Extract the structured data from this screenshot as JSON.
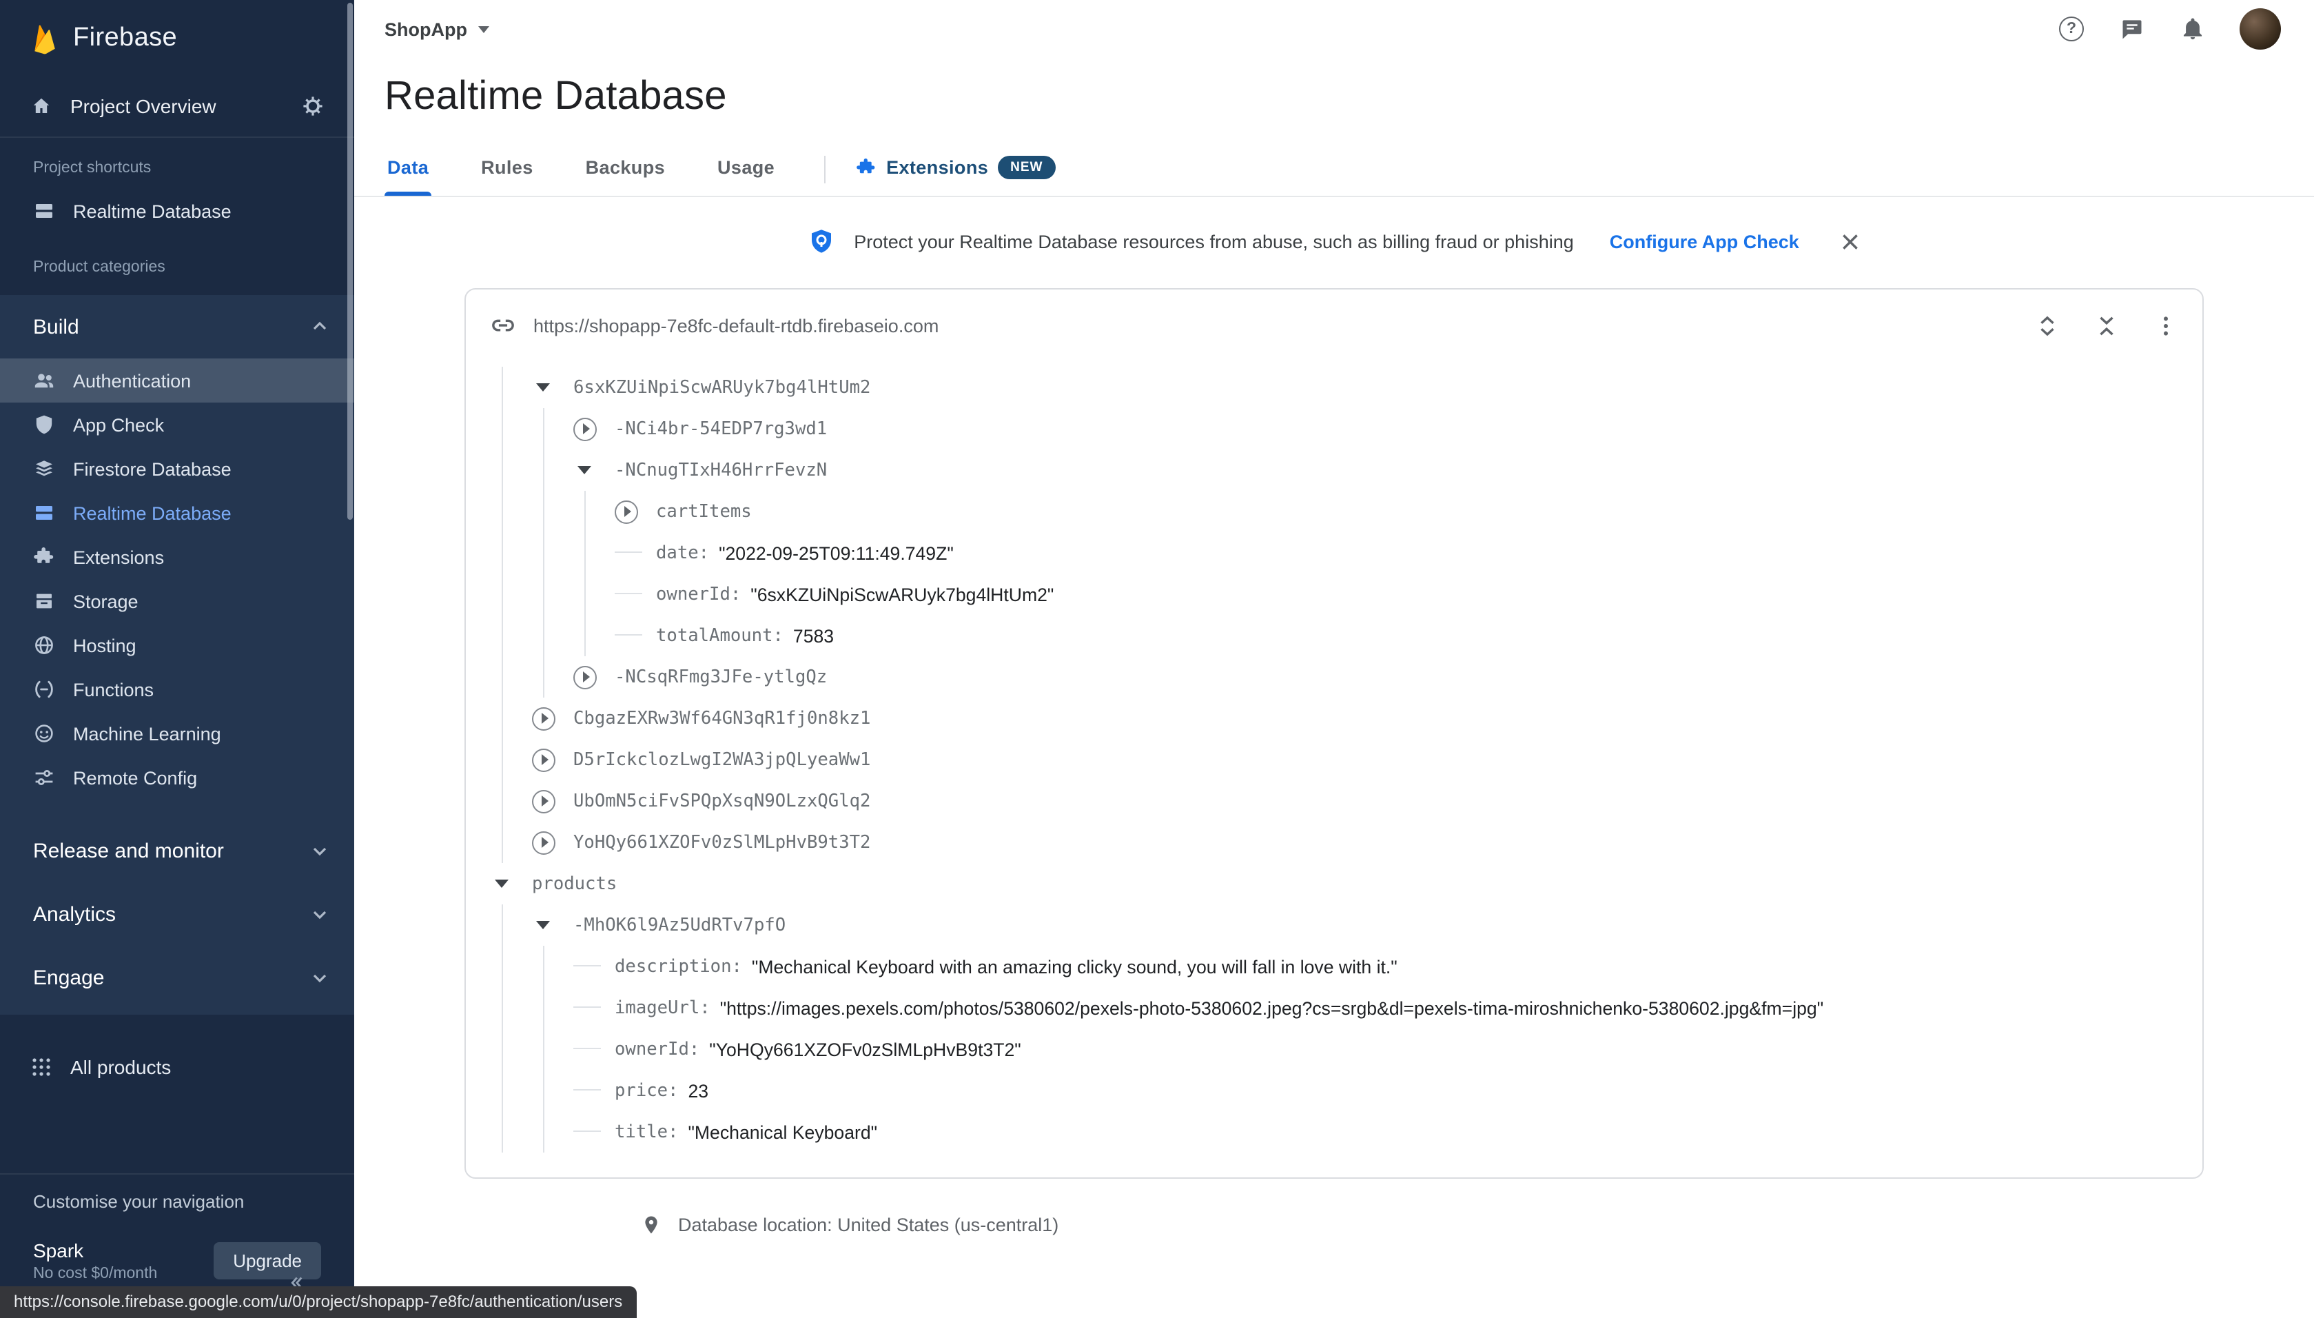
{
  "sidebar": {
    "brand": "Firebase",
    "project_overview": "Project Overview",
    "shortcuts_label": "Project shortcuts",
    "shortcut_realtime_database": "Realtime Database",
    "categories_label": "Product categories",
    "build_label": "Build",
    "build_items": [
      {
        "label": "Authentication"
      },
      {
        "label": "App Check"
      },
      {
        "label": "Firestore Database"
      },
      {
        "label": "Realtime Database"
      },
      {
        "label": "Extensions"
      },
      {
        "label": "Storage"
      },
      {
        "label": "Hosting"
      },
      {
        "label": "Functions"
      },
      {
        "label": "Machine Learning"
      },
      {
        "label": "Remote Config"
      }
    ],
    "sections": [
      {
        "label": "Release and monitor"
      },
      {
        "label": "Analytics"
      },
      {
        "label": "Engage"
      }
    ],
    "all_products": "All products",
    "customise": "Customise your navigation",
    "plan_name": "Spark",
    "plan_detail": "No cost $0/month",
    "upgrade": "Upgrade"
  },
  "topbar": {
    "project": "ShopApp",
    "help_glyph": "?"
  },
  "page": {
    "title": "Realtime Database",
    "tabs": [
      "Data",
      "Rules",
      "Backups",
      "Usage",
      "Extensions"
    ],
    "extensions_badge": "NEW"
  },
  "banner": {
    "text": "Protect your Realtime Database resources from abuse, such as billing fraud or phishing",
    "action": "Configure App Check"
  },
  "db": {
    "url": "https://shopapp-7e8fc-default-rtdb.firebaseio.com",
    "location": "Database location: United States (us-central1)"
  },
  "tree": {
    "rows": [
      {
        "key": "6sxKZUiNpiScwARUyk7bg4lHtUm2"
      },
      {
        "key": "-NCi4br-54EDP7rg3wd1"
      },
      {
        "key": "-NCnugTIxH46HrrFevzN"
      },
      {
        "key": "cartItems"
      },
      {
        "key": "date:",
        "value": "\"2022-09-25T09:11:49.749Z\""
      },
      {
        "key": "ownerId:",
        "value": "\"6sxKZUiNpiScwARUyk7bg4lHtUm2\""
      },
      {
        "key": "totalAmount:",
        "value": "7583"
      },
      {
        "key": "-NCsqRFmg3JFe-ytlgQz"
      },
      {
        "key": "CbgazEXRw3Wf64GN3qR1fj0n8kz1"
      },
      {
        "key": "D5rIckclozLwgI2WA3jpQLyeaWw1"
      },
      {
        "key": "UbOmN5ciFvSPQpXsqN9OLzxQGlq2"
      },
      {
        "key": "YoHQy661XZOFv0zSlMLpHvB9t3T2"
      },
      {
        "key": "products"
      },
      {
        "key": "-MhOK6l9Az5UdRTv7pfO"
      },
      {
        "key": "description:",
        "value": "\"Mechanical Keyboard with an amazing clicky sound, you will fall in love with it.\""
      },
      {
        "key": "imageUrl:",
        "value": "\"https://images.pexels.com/photos/5380602/pexels-photo-5380602.jpeg?cs=srgb&dl=pexels-tima-miroshnichenko-5380602.jpg&fm=jpg\""
      },
      {
        "key": "ownerId:",
        "value": "\"YoHQy661XZOFv0zSlMLpHvB9t3T2\""
      },
      {
        "key": "price:",
        "value": "23"
      },
      {
        "key": "title:",
        "value": "\"Mechanical Keyboard\""
      }
    ]
  },
  "status_url": "https://console.firebase.google.com/u/0/project/shopapp-7e8fc/authentication/users",
  "colors": {
    "accent": "#1a73e8",
    "active_tab": "#1967d2",
    "sidebar_active": "#7cacf8",
    "badge_bg": "#1d4e74"
  }
}
